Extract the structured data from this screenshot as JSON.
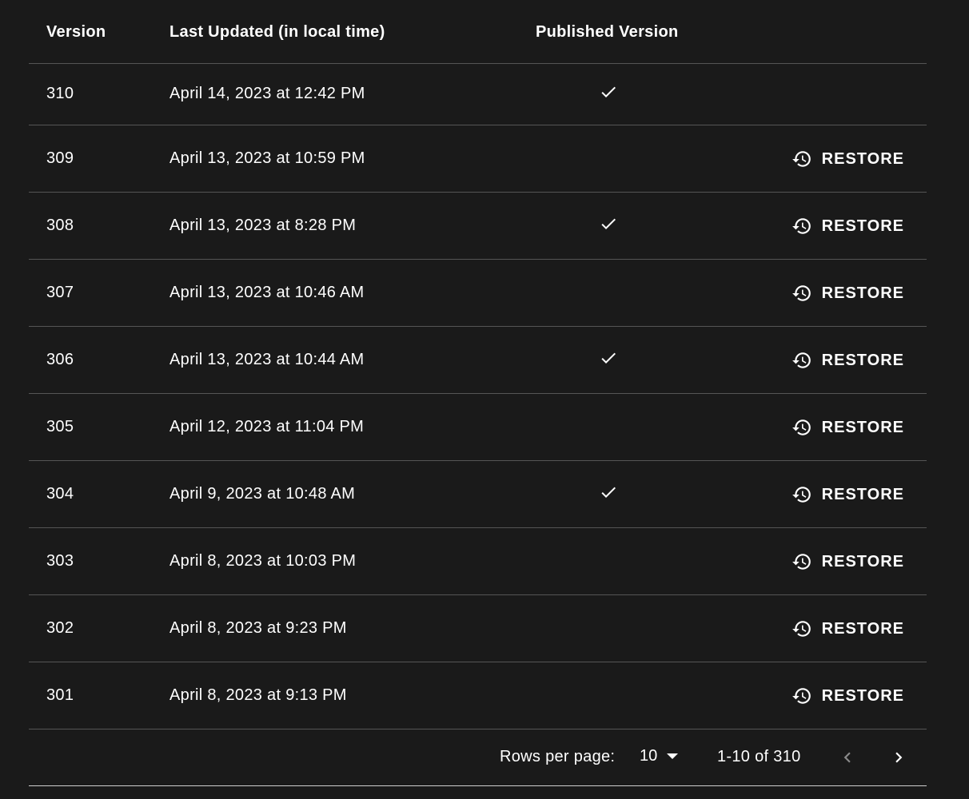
{
  "table": {
    "headers": {
      "version": "Version",
      "last_updated": "Last Updated (in local time)",
      "published": "Published Version"
    },
    "restore_label": "RESTORE",
    "rows": [
      {
        "version": "310",
        "updated": "April 14, 2023 at 12:42 PM",
        "published": true,
        "restorable": false
      },
      {
        "version": "309",
        "updated": "April 13, 2023 at 10:59 PM",
        "published": false,
        "restorable": true
      },
      {
        "version": "308",
        "updated": "April 13, 2023 at 8:28 PM",
        "published": true,
        "restorable": true
      },
      {
        "version": "307",
        "updated": "April 13, 2023 at 10:46 AM",
        "published": false,
        "restorable": true
      },
      {
        "version": "306",
        "updated": "April 13, 2023 at 10:44 AM",
        "published": true,
        "restorable": true
      },
      {
        "version": "305",
        "updated": "April 12, 2023 at 11:04 PM",
        "published": false,
        "restorable": true
      },
      {
        "version": "304",
        "updated": "April 9, 2023 at 10:48 AM",
        "published": true,
        "restorable": true
      },
      {
        "version": "303",
        "updated": "April 8, 2023 at 10:03 PM",
        "published": false,
        "restorable": true
      },
      {
        "version": "302",
        "updated": "April 8, 2023 at 9:23 PM",
        "published": false,
        "restorable": true
      },
      {
        "version": "301",
        "updated": "April 8, 2023 at 9:13 PM",
        "published": false,
        "restorable": true
      }
    ]
  },
  "pagination": {
    "rows_per_page_label": "Rows per page:",
    "rows_per_page_value": "10",
    "range": "1-10 of 310",
    "prev_icon": "chevron-left-icon",
    "next_icon": "chevron-right-icon"
  },
  "icons": {
    "check": "check-icon",
    "restore": "history-icon"
  },
  "colors": {
    "background": "#1a1a1a",
    "text": "#ffffff",
    "divider": "#555555",
    "disabled": "#8a8a8a"
  }
}
